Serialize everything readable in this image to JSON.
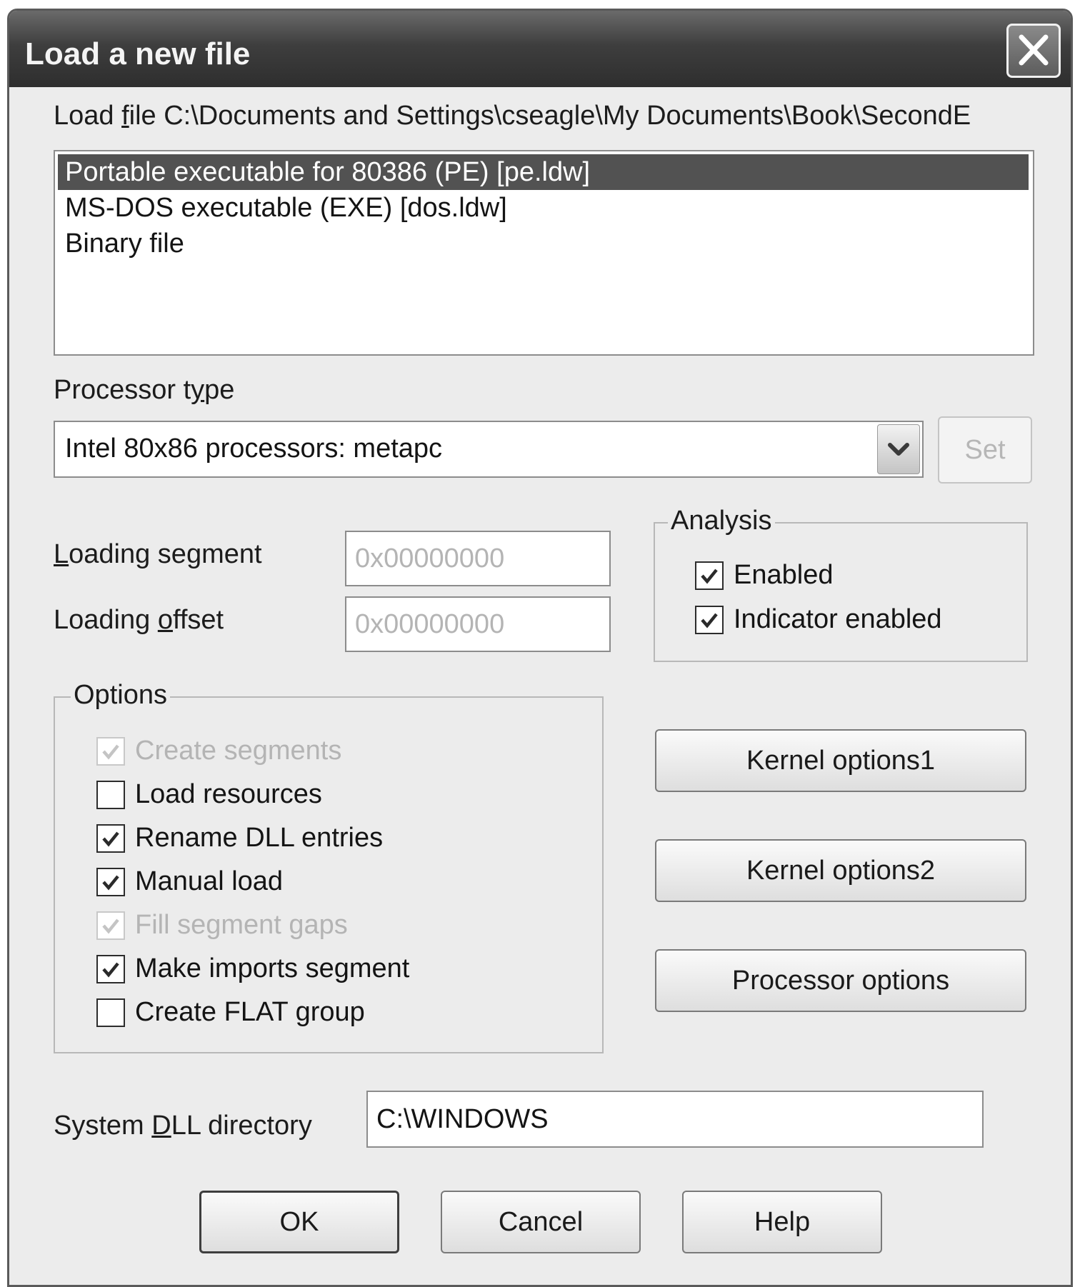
{
  "window": {
    "title": "Load a new file",
    "close_icon": "close-icon"
  },
  "load_file": {
    "label_prefix": "Load ",
    "label_underlined": "f",
    "label_rest": "ile C:\\Documents and Settings\\cseagle\\My Documents\\Book\\SecondE",
    "items": [
      {
        "label": "Portable executable for 80386 (PE) [pe.ldw]",
        "selected": true
      },
      {
        "label": "MS-DOS executable (EXE) [dos.ldw]",
        "selected": false
      },
      {
        "label": "Binary file",
        "selected": false
      }
    ]
  },
  "processor": {
    "label_pre": "Processor t",
    "label_u": "y",
    "label_post": "pe",
    "selected": "Intel 80x86 processors: metapc",
    "dropdown_icon": "chevron-down-icon",
    "set_button": "Set",
    "set_enabled": false
  },
  "loading": {
    "segment_label_u": "L",
    "segment_label_rest": "oading segment",
    "segment_value": "0x00000000",
    "offset_label_pre": "Loading ",
    "offset_label_u": "o",
    "offset_label_post": "ffset",
    "offset_value": "0x00000000"
  },
  "analysis": {
    "title": "Analysis",
    "enabled_label": "Enabled",
    "enabled_checked": true,
    "indicator_label": "Indicator enabled",
    "indicator_checked": true
  },
  "options": {
    "title": "Options",
    "items": [
      {
        "label": "Create segments",
        "checked": true,
        "disabled": true
      },
      {
        "label": "Load resources",
        "checked": false,
        "disabled": false
      },
      {
        "label": "Rename DLL entries",
        "checked": true,
        "disabled": false
      },
      {
        "label": "Manual load",
        "checked": true,
        "disabled": false
      },
      {
        "label": "Fill segment gaps",
        "checked": true,
        "disabled": true
      },
      {
        "label": "Make imports segment",
        "checked": true,
        "disabled": false
      },
      {
        "label": "Create FLAT group",
        "checked": false,
        "disabled": false
      }
    ]
  },
  "side_buttons": {
    "kernel1": "Kernel options1",
    "kernel2": "Kernel options2",
    "processor_options": "Processor options"
  },
  "dll": {
    "label_pre": "System ",
    "label_u": "D",
    "label_post": "LL directory",
    "value": "C:\\WINDOWS"
  },
  "footer": {
    "ok": "OK",
    "cancel": "Cancel",
    "help": "Help"
  }
}
